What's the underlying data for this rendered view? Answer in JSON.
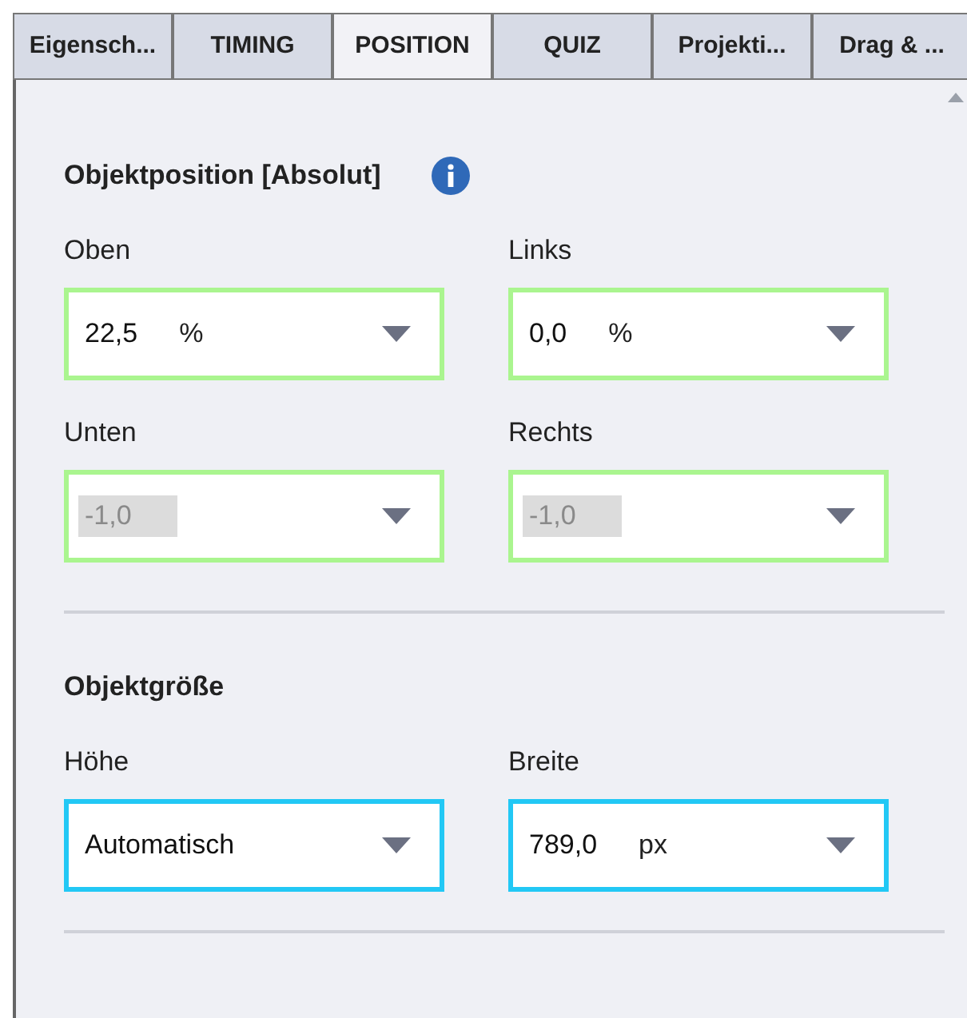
{
  "tabs": [
    {
      "label": "Eigensch...",
      "selected": false
    },
    {
      "label": "TIMING",
      "selected": false
    },
    {
      "label": "POSITION",
      "selected": true
    },
    {
      "label": "QUIZ",
      "selected": false
    },
    {
      "label": "Projekti...",
      "selected": false
    },
    {
      "label": "Drag & ...",
      "selected": false
    }
  ],
  "sections": [
    {
      "title": "Objektposition [Absolut]",
      "info": true,
      "fields": [
        {
          "label": "Oben",
          "value": "22,5",
          "unit": "%",
          "disabled": false,
          "color": "#aaf58f"
        },
        {
          "label": "Links",
          "value": "0,0",
          "unit": "%",
          "disabled": false,
          "color": "#aaf58f"
        },
        {
          "label": "Unten",
          "value": "-1,0",
          "disabled": true,
          "color": "#aaf58f"
        },
        {
          "label": "Rechts",
          "value": "-1,0",
          "disabled": true,
          "color": "#aaf58f"
        }
      ]
    },
    {
      "title": "Objektgröße",
      "info": false,
      "fields": [
        {
          "label": "Höhe",
          "value": "Automatisch",
          "disabled": false,
          "color": "#22c8f5"
        },
        {
          "label": "Breite",
          "value": "789,0",
          "unit": "px",
          "disabled": false,
          "color": "#22c8f5"
        }
      ]
    }
  ]
}
